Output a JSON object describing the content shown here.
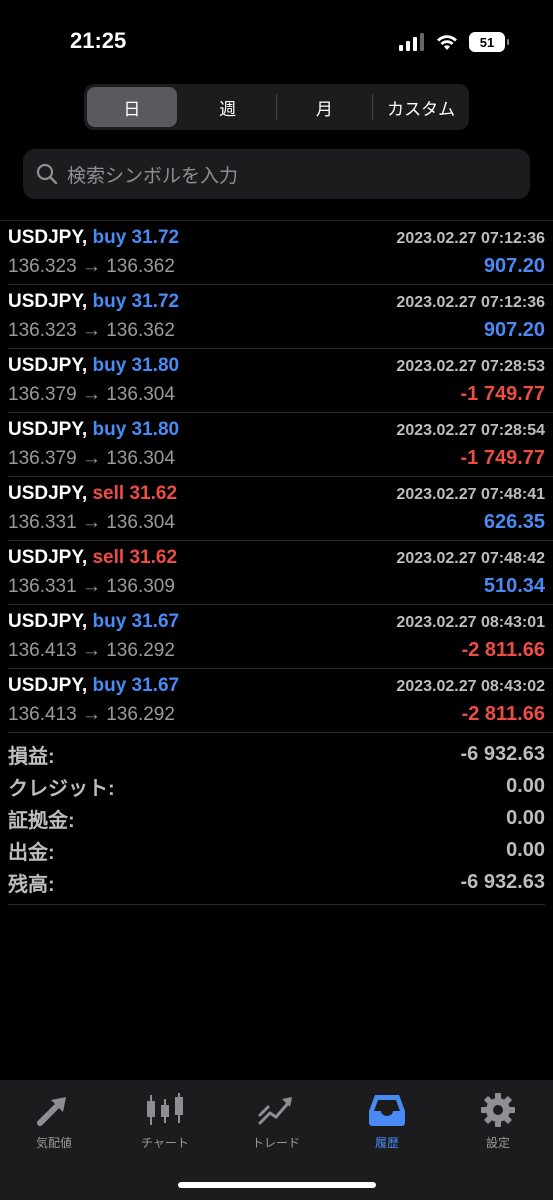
{
  "status": {
    "time": "21:25",
    "battery": "51"
  },
  "period_tabs": [
    {
      "label": "日",
      "active": true
    },
    {
      "label": "週",
      "active": false
    },
    {
      "label": "月",
      "active": false
    },
    {
      "label": "カスタム",
      "active": false
    }
  ],
  "search": {
    "placeholder": "検索シンボルを入力"
  },
  "deals": [
    {
      "symbol": "USDJPY,",
      "side": "buy",
      "volume": "31.72",
      "time": "2023.02.27 07:12:36",
      "prices": "136.323 → 136.362",
      "profit": "907.20",
      "profit_sign": "pos"
    },
    {
      "symbol": "USDJPY,",
      "side": "buy",
      "volume": "31.72",
      "time": "2023.02.27 07:12:36",
      "prices": "136.323 → 136.362",
      "profit": "907.20",
      "profit_sign": "pos"
    },
    {
      "symbol": "USDJPY,",
      "side": "buy",
      "volume": "31.80",
      "time": "2023.02.27 07:28:53",
      "prices": "136.379 → 136.304",
      "profit": "-1 749.77",
      "profit_sign": "neg"
    },
    {
      "symbol": "USDJPY,",
      "side": "buy",
      "volume": "31.80",
      "time": "2023.02.27 07:28:54",
      "prices": "136.379 → 136.304",
      "profit": "-1 749.77",
      "profit_sign": "neg"
    },
    {
      "symbol": "USDJPY,",
      "side": "sell",
      "volume": "31.62",
      "time": "2023.02.27 07:48:41",
      "prices": "136.331 → 136.304",
      "profit": "626.35",
      "profit_sign": "pos"
    },
    {
      "symbol": "USDJPY,",
      "side": "sell",
      "volume": "31.62",
      "time": "2023.02.27 07:48:42",
      "prices": "136.331 → 136.309",
      "profit": "510.34",
      "profit_sign": "pos"
    },
    {
      "symbol": "USDJPY,",
      "side": "buy",
      "volume": "31.67",
      "time": "2023.02.27 08:43:01",
      "prices": "136.413 → 136.292",
      "profit": "-2 811.66",
      "profit_sign": "neg"
    },
    {
      "symbol": "USDJPY,",
      "side": "buy",
      "volume": "31.67",
      "time": "2023.02.27 08:43:02",
      "prices": "136.413 → 136.292",
      "profit": "-2 811.66",
      "profit_sign": "neg"
    }
  ],
  "summary": [
    {
      "label": "損益:",
      "value": "-6 932.63"
    },
    {
      "label": "クレジット:",
      "value": "0.00"
    },
    {
      "label": "証拠金:",
      "value": "0.00"
    },
    {
      "label": "出金:",
      "value": "0.00"
    },
    {
      "label": "残高:",
      "value": "-6 932.63"
    }
  ],
  "tabbar": [
    {
      "label": "気配値",
      "icon": "quotes-arrows-icon",
      "active": false
    },
    {
      "label": "チャート",
      "icon": "candlestick-chart-icon",
      "active": false
    },
    {
      "label": "トレード",
      "icon": "trade-trend-icon",
      "active": false
    },
    {
      "label": "履歴",
      "icon": "history-inbox-icon",
      "active": true
    },
    {
      "label": "設定",
      "icon": "gear-icon",
      "active": false
    }
  ],
  "colors": {
    "buy": "#4a8af4",
    "sell": "#ee4c45",
    "active_tab": "#4a8af4"
  }
}
